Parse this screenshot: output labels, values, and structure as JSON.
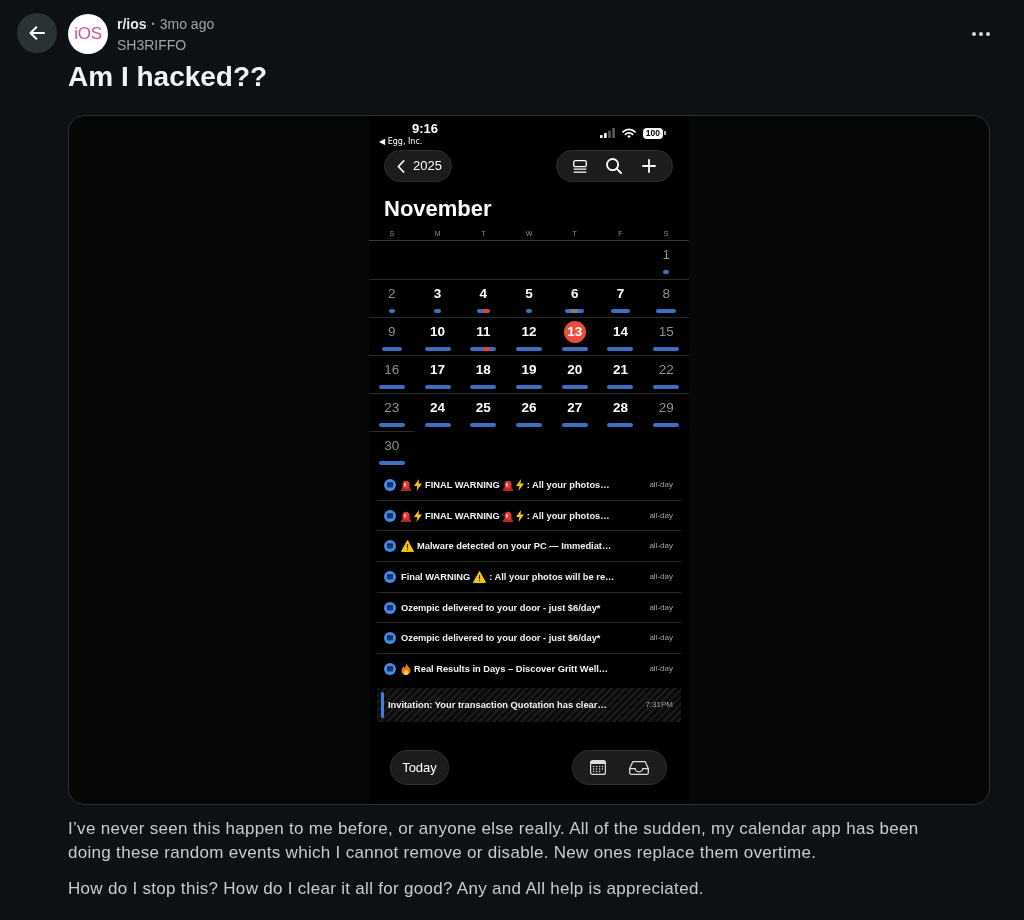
{
  "header": {
    "avatar_text": "iOS",
    "subreddit": "r/ios",
    "separator": "•",
    "age": "3mo ago",
    "author": "SH3RIFFO"
  },
  "post": {
    "title": "Am I hacked??",
    "body": [
      "I’ve never seen this happen to me before, or anyone else really. All of the sudden, my calendar app has been doing these random events which I cannot remove or disable. New ones replace them overtime.",
      "How do I stop this? How do I clear it all for good? Any and All help is appreciated."
    ]
  },
  "phone": {
    "status_bar": {
      "time": "9:16",
      "back_app": "◀ Egg, Inc.",
      "battery": "100"
    },
    "year_button": "2025",
    "month": "November",
    "weekdays": [
      "S",
      "M",
      "T",
      "W",
      "T",
      "F",
      "S"
    ],
    "weeks": [
      {
        "days": [
          {
            "day": "1",
            "weekend": true,
            "today": false,
            "events": [
              {
                "color": "#3c6fc4"
              }
            ]
          }
        ]
      },
      {
        "days": [
          {
            "day": "2",
            "weekend": true,
            "today": false,
            "events": [
              {
                "color": "#3c6fc4"
              }
            ]
          },
          {
            "day": "3",
            "weekend": false,
            "today": false,
            "events": [
              {
                "color": "#3c6fc4"
              }
            ]
          },
          {
            "day": "4",
            "weekend": false,
            "today": false,
            "events": [
              {
                "color": "#3c6fc4"
              },
              {
                "color": "#d8453f"
              }
            ]
          },
          {
            "day": "5",
            "weekend": false,
            "today": false,
            "events": [
              {
                "color": "#3c6fc4"
              }
            ]
          },
          {
            "day": "6",
            "weekend": false,
            "today": false,
            "events": [
              {
                "color": "#3c6fc4"
              },
              {
                "color": "#7d7d82"
              },
              {
                "color": "#3c6fc4"
              }
            ]
          },
          {
            "day": "7",
            "weekend": false,
            "today": false,
            "events": [
              {
                "color": "#3c6fc4"
              },
              {
                "color": "#3c6fc4"
              },
              {
                "color": "#3c6fc4"
              }
            ]
          },
          {
            "day": "8",
            "weekend": true,
            "today": false,
            "events": [
              {
                "color": "#3c6fc4"
              },
              {
                "color": "#3c6fc4"
              },
              {
                "color": "#3c6fc4"
              }
            ]
          }
        ]
      },
      {
        "days": [
          {
            "day": "9",
            "weekend": true,
            "today": false,
            "events": [
              {
                "color": "#3c6fc4"
              },
              {
                "color": "#3c6fc4"
              },
              {
                "color": "#3c6fc4"
              }
            ]
          },
          {
            "day": "10",
            "weekend": false,
            "today": false,
            "events": [
              {
                "color": "#3c6fc4"
              },
              {
                "color": "#3c6fc4"
              },
              {
                "color": "#3c6fc4"
              },
              {
                "color": "#3c6fc4"
              }
            ]
          },
          {
            "day": "11",
            "weekend": false,
            "today": false,
            "events": [
              {
                "color": "#3c6fc4"
              },
              {
                "color": "#3c6fc4"
              },
              {
                "color": "#d8453f"
              },
              {
                "color": "#3c6fc4"
              }
            ]
          },
          {
            "day": "12",
            "weekend": false,
            "today": false,
            "events": [
              {
                "color": "#3c6fc4"
              },
              {
                "color": "#3c6fc4"
              },
              {
                "color": "#3c6fc4"
              },
              {
                "color": "#3c6fc4"
              }
            ]
          },
          {
            "day": "13",
            "weekend": false,
            "today": true,
            "events": [
              {
                "color": "#3c6fc4"
              },
              {
                "color": "#3c6fc4"
              },
              {
                "color": "#3c6fc4"
              },
              {
                "color": "#3c6fc4"
              }
            ]
          },
          {
            "day": "14",
            "weekend": false,
            "today": false,
            "events": [
              {
                "color": "#3c6fc4"
              },
              {
                "color": "#3c6fc4"
              },
              {
                "color": "#3c6fc4"
              },
              {
                "color": "#3c6fc4"
              }
            ]
          },
          {
            "day": "15",
            "weekend": true,
            "today": false,
            "events": [
              {
                "color": "#3c6fc4"
              },
              {
                "color": "#3c6fc4"
              },
              {
                "color": "#3c6fc4"
              },
              {
                "color": "#3c6fc4"
              }
            ]
          }
        ]
      },
      {
        "days": [
          {
            "day": "16",
            "weekend": true,
            "today": false,
            "events": [
              {
                "color": "#3c6fc4"
              },
              {
                "color": "#3c6fc4"
              },
              {
                "color": "#3c6fc4"
              },
              {
                "color": "#3c6fc4"
              }
            ]
          },
          {
            "day": "17",
            "weekend": false,
            "today": false,
            "events": [
              {
                "color": "#3c6fc4"
              },
              {
                "color": "#3c6fc4"
              },
              {
                "color": "#3c6fc4"
              },
              {
                "color": "#3c6fc4"
              }
            ]
          },
          {
            "day": "18",
            "weekend": false,
            "today": false,
            "events": [
              {
                "color": "#3c6fc4"
              },
              {
                "color": "#3c6fc4"
              },
              {
                "color": "#3c6fc4"
              },
              {
                "color": "#3c6fc4"
              }
            ]
          },
          {
            "day": "19",
            "weekend": false,
            "today": false,
            "events": [
              {
                "color": "#3c6fc4"
              },
              {
                "color": "#3c6fc4"
              },
              {
                "color": "#3c6fc4"
              },
              {
                "color": "#3c6fc4"
              }
            ]
          },
          {
            "day": "20",
            "weekend": false,
            "today": false,
            "events": [
              {
                "color": "#3c6fc4"
              },
              {
                "color": "#3c6fc4"
              },
              {
                "color": "#3c6fc4"
              },
              {
                "color": "#3c6fc4"
              }
            ]
          },
          {
            "day": "21",
            "weekend": false,
            "today": false,
            "events": [
              {
                "color": "#3c6fc4"
              },
              {
                "color": "#3c6fc4"
              },
              {
                "color": "#3c6fc4"
              },
              {
                "color": "#3c6fc4"
              }
            ]
          },
          {
            "day": "22",
            "weekend": true,
            "today": false,
            "events": [
              {
                "color": "#3c6fc4"
              },
              {
                "color": "#3c6fc4"
              },
              {
                "color": "#3c6fc4"
              },
              {
                "color": "#3c6fc4"
              }
            ]
          }
        ]
      },
      {
        "days": [
          {
            "day": "23",
            "weekend": true,
            "today": false,
            "events": [
              {
                "color": "#3c6fc4"
              },
              {
                "color": "#3c6fc4"
              },
              {
                "color": "#3c6fc4"
              },
              {
                "color": "#3c6fc4"
              }
            ]
          },
          {
            "day": "24",
            "weekend": false,
            "today": false,
            "events": [
              {
                "color": "#3c6fc4"
              },
              {
                "color": "#3c6fc4"
              },
              {
                "color": "#3c6fc4"
              },
              {
                "color": "#3c6fc4"
              }
            ]
          },
          {
            "day": "25",
            "weekend": false,
            "today": false,
            "events": [
              {
                "color": "#3c6fc4"
              },
              {
                "color": "#3c6fc4"
              },
              {
                "color": "#3c6fc4"
              },
              {
                "color": "#3c6fc4"
              }
            ]
          },
          {
            "day": "26",
            "weekend": false,
            "today": false,
            "events": [
              {
                "color": "#3c6fc4"
              },
              {
                "color": "#3c6fc4"
              },
              {
                "color": "#3c6fc4"
              },
              {
                "color": "#3c6fc4"
              }
            ]
          },
          {
            "day": "27",
            "weekend": false,
            "today": false,
            "events": [
              {
                "color": "#3c6fc4"
              },
              {
                "color": "#3c6fc4"
              },
              {
                "color": "#3c6fc4"
              },
              {
                "color": "#3c6fc4"
              }
            ]
          },
          {
            "day": "28",
            "weekend": false,
            "today": false,
            "events": [
              {
                "color": "#3c6fc4"
              },
              {
                "color": "#3c6fc4"
              },
              {
                "color": "#3c6fc4"
              },
              {
                "color": "#3c6fc4"
              }
            ]
          },
          {
            "day": "29",
            "weekend": true,
            "today": false,
            "events": [
              {
                "color": "#3c6fc4"
              },
              {
                "color": "#3c6fc4"
              },
              {
                "color": "#3c6fc4"
              },
              {
                "color": "#3c6fc4"
              }
            ]
          }
        ]
      },
      {
        "days": [
          {
            "day": "30",
            "weekend": true,
            "today": false,
            "events": [
              {
                "color": "#3c6fc4"
              },
              {
                "color": "#3c6fc4"
              },
              {
                "color": "#3c6fc4"
              },
              {
                "color": "#3c6fc4"
              }
            ]
          }
        ]
      }
    ],
    "events": [
      {
        "kind": "allday",
        "title": [
          {
            "kind": "siren"
          },
          {
            "kind": "bolt"
          },
          {
            "kind": "text",
            "text": "FINAL WARNING"
          },
          {
            "kind": "siren"
          },
          {
            "kind": "bolt"
          },
          {
            "kind": "text",
            "text": ": All your photos…"
          }
        ],
        "time": "all-day"
      },
      {
        "kind": "allday",
        "title": [
          {
            "kind": "siren"
          },
          {
            "kind": "bolt"
          },
          {
            "kind": "text",
            "text": "FINAL WARNING"
          },
          {
            "kind": "siren"
          },
          {
            "kind": "bolt"
          },
          {
            "kind": "text",
            "text": ": All your photos…"
          }
        ],
        "time": "all-day"
      },
      {
        "kind": "allday",
        "title": [
          {
            "kind": "warning"
          },
          {
            "kind": "text",
            "text": "Malware detected on your PC — Immediat…"
          }
        ],
        "time": "all-day"
      },
      {
        "kind": "allday",
        "title": [
          {
            "kind": "text",
            "text": "Final WARNING"
          },
          {
            "kind": "warning"
          },
          {
            "kind": "text",
            "text": ": All your photos will be re…"
          }
        ],
        "time": "all-day"
      },
      {
        "kind": "allday",
        "title": [
          {
            "kind": "text",
            "text": "Ozempic delivered to your door - just $6/day*"
          }
        ],
        "time": "all-day"
      },
      {
        "kind": "allday",
        "title": [
          {
            "kind": "text",
            "text": "Ozempic delivered to your door - just $6/day*"
          }
        ],
        "time": "all-day"
      },
      {
        "kind": "allday",
        "title": [
          {
            "kind": "fire"
          },
          {
            "kind": "text",
            "text": "Real Results in Days – Discover Gritt Well…"
          }
        ],
        "time": "all-day"
      },
      {
        "kind": "timed",
        "title": [
          {
            "kind": "text",
            "text": "Invitation: Your transaction Quotation has clear…"
          }
        ],
        "time": "7:31PM"
      }
    ],
    "today_button": "Today"
  }
}
